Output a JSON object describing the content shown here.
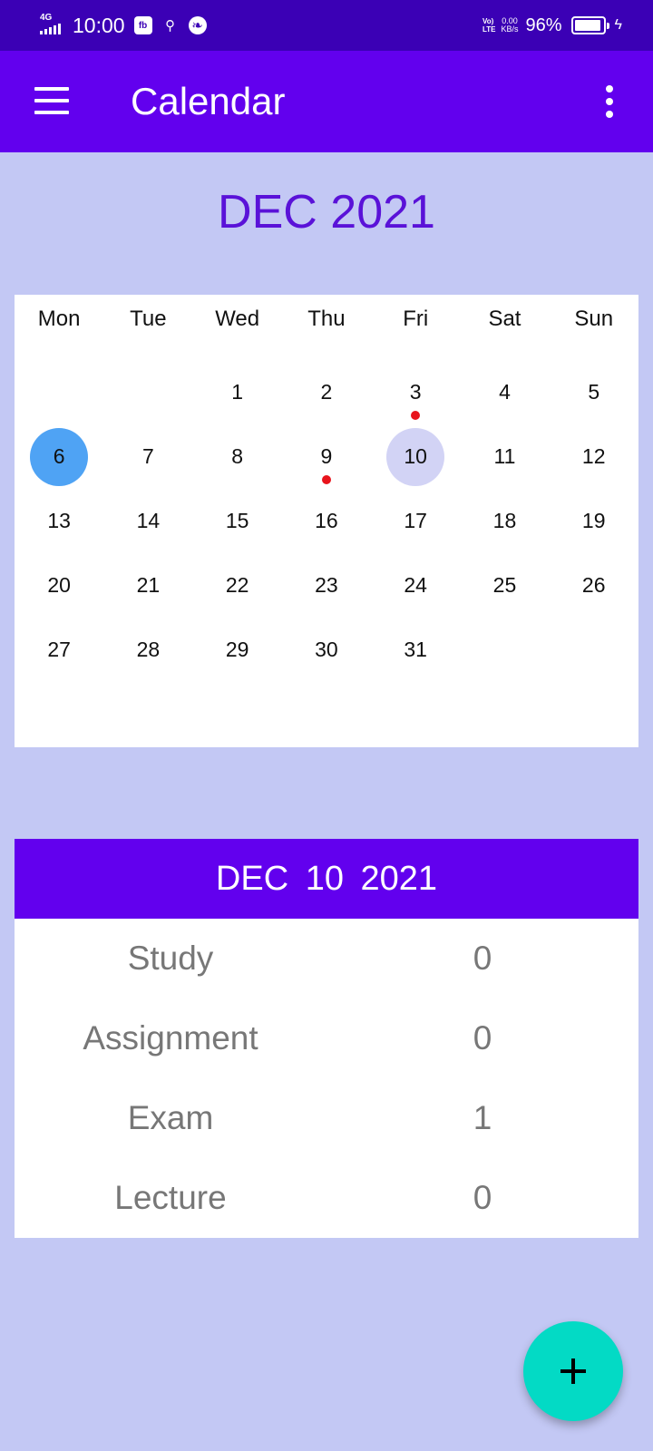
{
  "status_bar": {
    "network": "4G",
    "time": "10:00",
    "volte_top": "Vo)",
    "volte_bottom": "LTE",
    "speed_value": "0.00",
    "speed_unit": "KB/s",
    "battery_percent": "96%",
    "battery_level": 0.96
  },
  "app_bar": {
    "title": "Calendar",
    "menu_icon": "hamburger-menu-icon",
    "more_icon": "more-vert-icon"
  },
  "calendar": {
    "month_title": "DEC 2021",
    "weekdays": [
      "Mon",
      "Tue",
      "Wed",
      "Thu",
      "Fri",
      "Sat",
      "Sun"
    ],
    "weeks": [
      [
        "",
        "",
        "1",
        "2",
        "3",
        "4",
        "5"
      ],
      [
        "6",
        "7",
        "8",
        "9",
        "10",
        "11",
        "12"
      ],
      [
        "13",
        "14",
        "15",
        "16",
        "17",
        "18",
        "19"
      ],
      [
        "20",
        "21",
        "22",
        "23",
        "24",
        "25",
        "26"
      ],
      [
        "27",
        "28",
        "29",
        "30",
        "31",
        "",
        ""
      ]
    ],
    "today": "6",
    "selected": "10",
    "event_days": [
      "3",
      "9"
    ],
    "today_color": "#4fa3f4",
    "selected_color": "#d2d3f5",
    "event_dot_color": "#e8141c"
  },
  "summary": {
    "date_title": "DEC  10  2021",
    "rows": [
      {
        "label": "Study",
        "count": "0"
      },
      {
        "label": "Assignment",
        "count": "0"
      },
      {
        "label": "Exam",
        "count": "1"
      },
      {
        "label": "Lecture",
        "count": "0"
      }
    ]
  },
  "fab": {
    "icon": "plus-icon",
    "color": "#03dac5"
  },
  "colors": {
    "primary": "#6200ee",
    "status_bar": "#3b00b5",
    "background": "#c3c8f4",
    "month_title": "#5a12d8"
  }
}
